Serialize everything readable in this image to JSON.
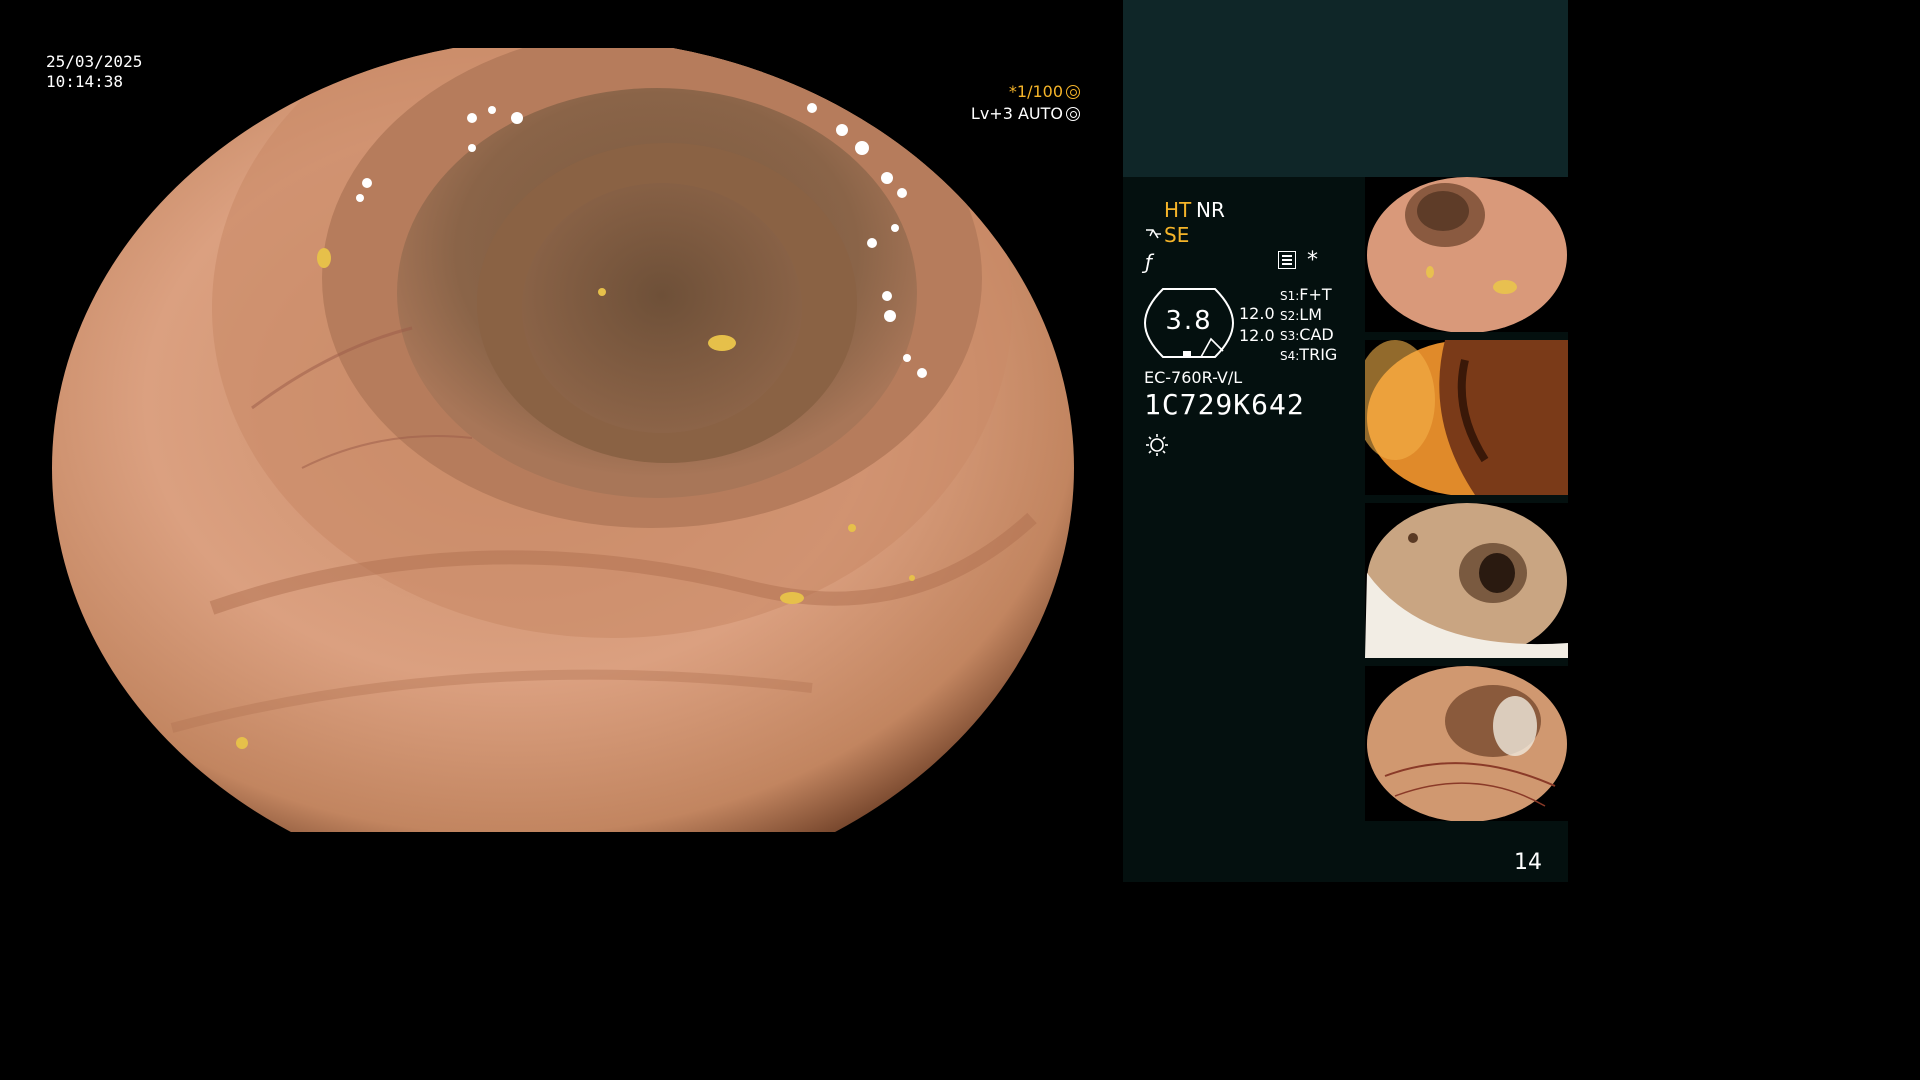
{
  "overlay": {
    "date": "25/03/2025",
    "time": "10:14:38",
    "shutter": "*1/100",
    "shutter_icon": "shutter-icon",
    "level": "Lv+3 AUTO",
    "level_icon": "auto-iris-icon"
  },
  "panel": {
    "mode_ht": "HT",
    "mode_nr": "NR",
    "mode_se": "SE",
    "se_icon": "structure-enhance-icon",
    "ff_icon": "f-icon",
    "ff_symbol": "ƒ",
    "menu_icon": "settings-sheet-icon",
    "asterisk": "*",
    "iris_value": "3.8",
    "gain_1": "12.0",
    "gain_2": "12.0",
    "switches": [
      {
        "key": "S1:",
        "value": "F+T"
      },
      {
        "key": "S2:",
        "value": "LM"
      },
      {
        "key": "S3:",
        "value": "CAD"
      },
      {
        "key": "S4:",
        "value": "TRIG"
      }
    ],
    "scope_model": "EC-760R-V/L",
    "scope_serial": "1C729K642",
    "light_icon": "light-source-icon"
  },
  "thumbnails": [
    {
      "name": "thumbnail-1",
      "tone": "pink-mucosa"
    },
    {
      "name": "thumbnail-2",
      "tone": "orange-fold"
    },
    {
      "name": "thumbnail-3",
      "tone": "fluid-lumen"
    },
    {
      "name": "thumbnail-4",
      "tone": "vascular-lumen"
    }
  ],
  "page_number": "14",
  "colors": {
    "accent_yellow": "#f5b429",
    "panel_top": "#0f2628",
    "panel_bottom": "#04100f"
  }
}
